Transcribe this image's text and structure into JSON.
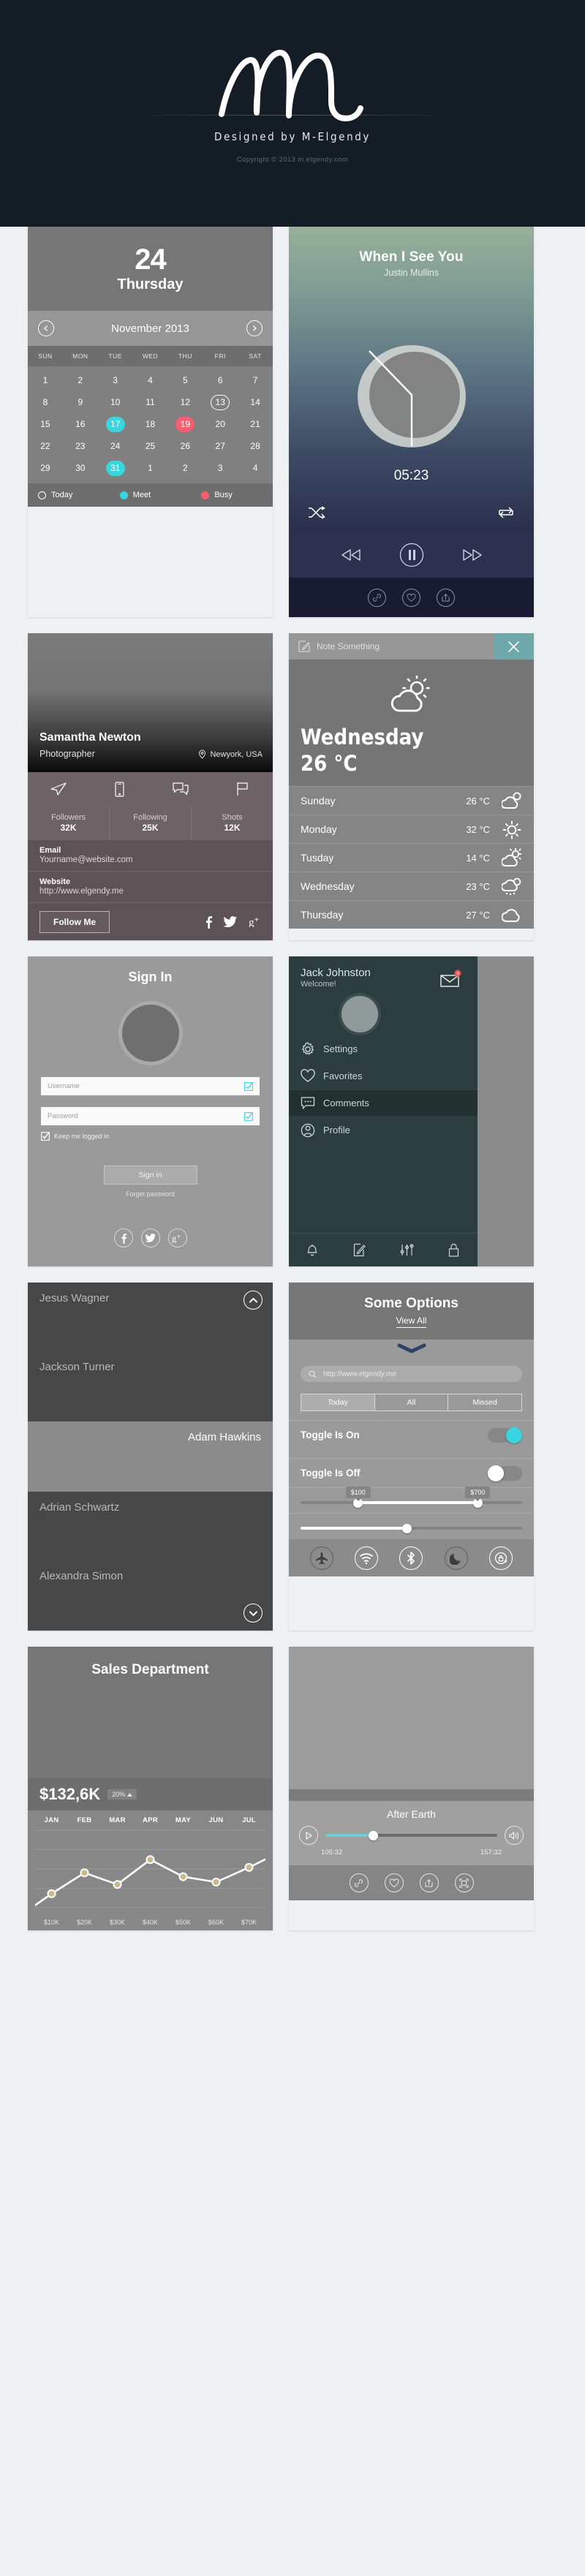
{
  "header": {
    "logo_name": "m-elgendy-logo",
    "designed_by": "Designed by M-Elgendy",
    "copyright": "Copyright © 2013 m.elgendy.com",
    "bg_color": "#141d26"
  },
  "calendar": {
    "day_number": "24",
    "day_name": "Thursday",
    "month_label": "November 2013",
    "prev_label": "‹",
    "next_label": "›",
    "dows": [
      "SUN",
      "MON",
      "TUE",
      "WED",
      "THU",
      "FRI",
      "SAT"
    ],
    "weeks": [
      [
        {
          "d": "1"
        },
        {
          "d": "2"
        },
        {
          "d": "3"
        },
        {
          "d": "4"
        },
        {
          "d": "5"
        },
        {
          "d": "6"
        },
        {
          "d": "7"
        }
      ],
      [
        {
          "d": "8"
        },
        {
          "d": "9"
        },
        {
          "d": "10"
        },
        {
          "d": "11"
        },
        {
          "d": "12"
        },
        {
          "d": "13",
          "s": "today"
        },
        {
          "d": "14"
        }
      ],
      [
        {
          "d": "15"
        },
        {
          "d": "16"
        },
        {
          "d": "17",
          "s": "meet"
        },
        {
          "d": "18"
        },
        {
          "d": "19",
          "s": "busy"
        },
        {
          "d": "20"
        },
        {
          "d": "21"
        }
      ],
      [
        {
          "d": "22"
        },
        {
          "d": "23"
        },
        {
          "d": "24"
        },
        {
          "d": "25"
        },
        {
          "d": "26"
        },
        {
          "d": "27"
        },
        {
          "d": "28"
        }
      ],
      [
        {
          "d": "29"
        },
        {
          "d": "30"
        },
        {
          "d": "31",
          "s": "meet"
        },
        {
          "d": "1"
        },
        {
          "d": "2"
        },
        {
          "d": "3"
        },
        {
          "d": "4"
        }
      ]
    ],
    "legend": [
      {
        "label": "Today",
        "type": "today"
      },
      {
        "label": "Meet",
        "type": "meet"
      },
      {
        "label": "Busy",
        "type": "busy"
      }
    ],
    "colors": {
      "meet": "#3ad6df",
      "busy": "#fa5d6e"
    }
  },
  "music": {
    "title": "When I See You",
    "artist": "Justin Mullins",
    "time": "05:23",
    "shuffle_icon": "shuffle-icon",
    "repeat_icon": "repeat-icon",
    "prev_icon": "previous-icon",
    "play_icon": "pause-icon",
    "next_icon": "next-icon",
    "footer_icons": [
      "link-icon",
      "heart-icon",
      "share-icon"
    ]
  },
  "profile": {
    "name": "Samantha Newton",
    "role": "Photographer",
    "location": "Newyork, USA",
    "action_icons": [
      "send-icon",
      "phone-icon",
      "chat-icon",
      "flag-icon"
    ],
    "stats": [
      {
        "label": "Followers",
        "value": "32K"
      },
      {
        "label": "Following",
        "value": "25K"
      },
      {
        "label": "Shots",
        "value": "12K"
      }
    ],
    "email_label": "Email",
    "email_value": "Yourname@website.com",
    "website_label": "Website",
    "website_value": "http://www.elgendy.me",
    "follow_label": "Follow Me",
    "social": [
      "facebook-icon",
      "twitter-icon",
      "googleplus-icon"
    ]
  },
  "note": {
    "placeholder": "Note Something",
    "close_label": "✕",
    "close_color": "#6fa8ab"
  },
  "weather": {
    "current_day": "Wednesday",
    "current_temp": "26 °C",
    "current_icon": "sun-cloud-icon",
    "forecast": [
      {
        "day": "Sunday",
        "temp": "26 °C",
        "icon": "cloud-sun-icon"
      },
      {
        "day": "Monday",
        "temp": "32 °C",
        "icon": "sun-icon"
      },
      {
        "day": "Tusday",
        "temp": "14 °C",
        "icon": "sun-cloud-icon"
      },
      {
        "day": "Wednesday",
        "temp": "23 °C",
        "icon": "cloud-rain-icon"
      },
      {
        "day": "Thursday",
        "temp": "27 °C",
        "icon": "cloud-icon"
      }
    ]
  },
  "signin": {
    "title": "Sign In",
    "username_placeholder": "Username",
    "password_placeholder": "Password",
    "keep_logged_label": "Keep me logged in",
    "submit_label": "Sign in",
    "forget_label": "Forget password",
    "social": [
      "facebook-icon",
      "twitter-icon",
      "googleplus-icon"
    ]
  },
  "menu": {
    "user_name": "Jack Johnston",
    "welcome": "Welcome!",
    "mail_badge": "9",
    "items": [
      {
        "label": "Settings",
        "icon": "gear-icon",
        "active": false
      },
      {
        "label": "Favorites",
        "icon": "heart-icon",
        "active": false
      },
      {
        "label": "Comments",
        "icon": "comment-icon",
        "active": true
      },
      {
        "label": "Profile",
        "icon": "user-icon",
        "active": false
      }
    ],
    "footer_icons": [
      "bell-icon",
      "edit-icon",
      "sliders-icon",
      "lock-icon"
    ]
  },
  "accordion": {
    "items": [
      {
        "name": "Jesus Wagner",
        "style": "dark",
        "chevron": "chevron-up-icon"
      },
      {
        "name": "Jackson Turner",
        "style": "dark",
        "chevron": null
      },
      {
        "name": "Adam Hawkins",
        "style": "light",
        "chevron": null
      },
      {
        "name": "Adrian Schwartz",
        "style": "dark",
        "chevron": null
      },
      {
        "name": "Alexandra Simon",
        "style": "dark",
        "chevron": "chevron-down-icon"
      }
    ]
  },
  "options": {
    "title": "Some Options",
    "view_all": "View All",
    "search_placeholder": "http://www.elgendy.me",
    "segments": [
      {
        "label": "Today",
        "selected": true
      },
      {
        "label": "All",
        "selected": false
      },
      {
        "label": "Missed",
        "selected": false
      }
    ],
    "toggle_on_label": "Toggle Is On",
    "toggle_off_label": "Toggle Is Off",
    "range_min_label": "$100",
    "range_max_label": "$700",
    "range_min_pct": 26,
    "range_max_pct": 80,
    "single_slider_pct": 48,
    "quick_toggles": [
      {
        "icon": "airplane-icon",
        "on": false
      },
      {
        "icon": "wifi-icon",
        "on": true
      },
      {
        "icon": "bluetooth-icon",
        "on": true
      },
      {
        "icon": "moon-icon",
        "on": false
      },
      {
        "icon": "rotation-lock-icon",
        "on": true
      }
    ],
    "accent_color": "#3ad6df"
  },
  "video": {
    "title": "After Earth",
    "current_time": "105:32",
    "total_time": "157:32",
    "progress_pct": 28,
    "play_icon": "play-icon",
    "volume_icon": "volume-icon",
    "footer_icons": [
      "link-icon",
      "heart-icon",
      "share-icon",
      "fullscreen-icon"
    ],
    "accent_color": "#6ccfd6"
  },
  "chart_data": {
    "type": "line",
    "title": "Sales Department",
    "total_value": "$132,6K",
    "change_badge": "20%",
    "change_direction": "up",
    "categories": [
      "JAN",
      "FEB",
      "MAR",
      "APR",
      "MAY",
      "JUN",
      "JUL"
    ],
    "values": [
      18,
      45,
      30,
      62,
      40,
      33,
      52
    ],
    "value_tick_labels": [
      "$10K",
      "$20K",
      "$30K",
      "$40K",
      "$50K",
      "$60K",
      "$70K"
    ],
    "xlabel": "",
    "ylabel": "",
    "ylim": [
      0,
      100
    ],
    "grid": true,
    "legend": "none",
    "line_color": "#ffffff",
    "marker_color": "#c9b98a"
  }
}
